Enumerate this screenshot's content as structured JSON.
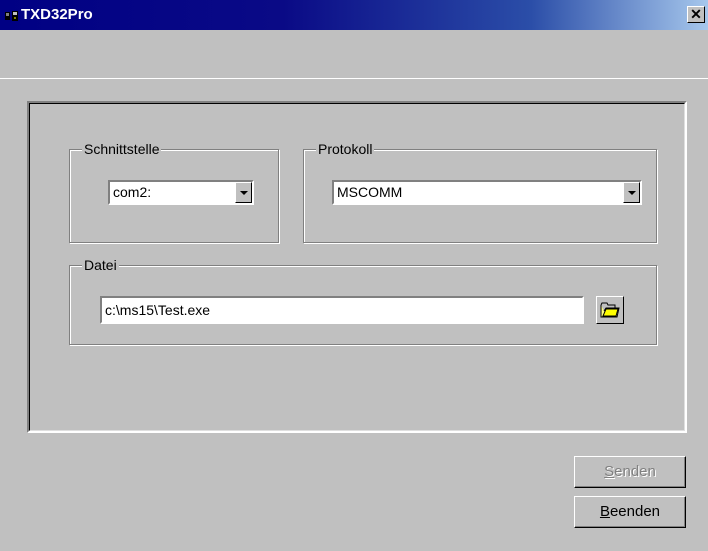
{
  "window": {
    "title": "TXD32Pro",
    "close_label": "✕"
  },
  "groups": {
    "interface": {
      "label": "Schnittstelle",
      "value": "com2:"
    },
    "protocol": {
      "label": "Protokoll",
      "value": "MSCOMM"
    },
    "file": {
      "label": "Datei",
      "value": "c:\\ms15\\Test.exe"
    }
  },
  "buttons": {
    "send": {
      "label_first": "S",
      "label_rest": "enden",
      "enabled": false
    },
    "quit": {
      "label_first": "B",
      "label_rest": "eenden",
      "enabled": true
    }
  },
  "icons": {
    "app": "app-icon",
    "browse": "folder-open-icon"
  }
}
